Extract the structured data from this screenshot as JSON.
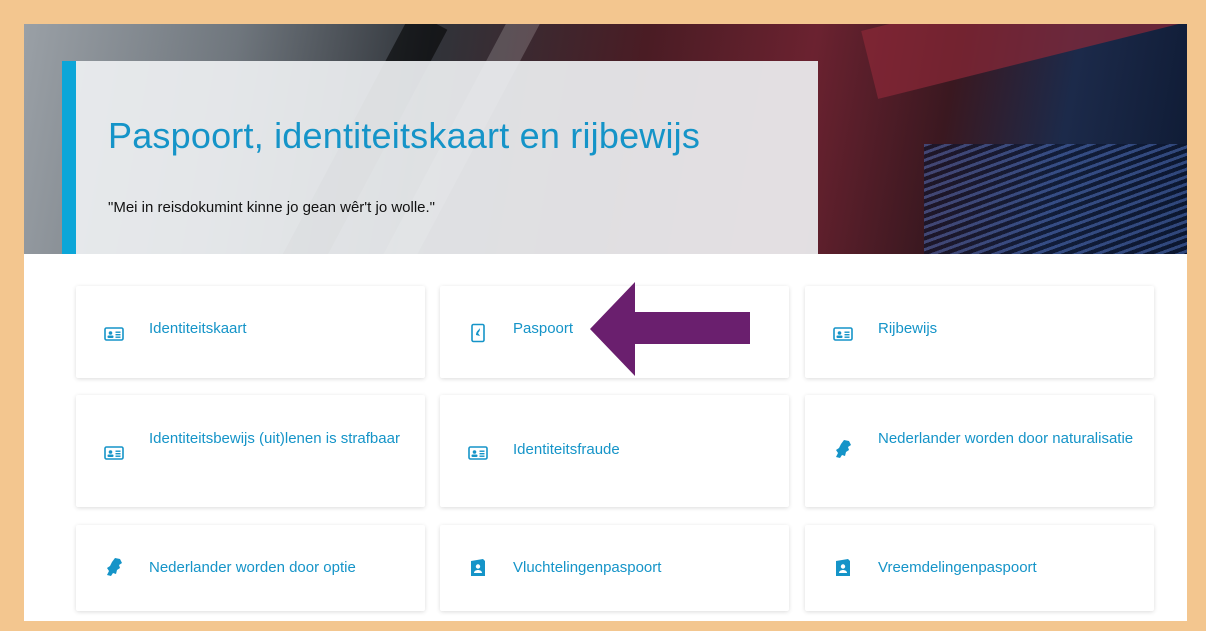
{
  "hero": {
    "title": "Paspoort, identiteitskaart en rijbewijs",
    "subtitle": "\"Mei in reisdokumint kinne jo gean wêr't jo wolle.\""
  },
  "colors": {
    "accent": "#1594c8",
    "panel_bar": "#0ca6d8",
    "frame": "#f3c68f",
    "arrow": "#6a1f6e"
  },
  "cards": [
    {
      "label": "Identiteitskaart",
      "icon": "id-card-icon"
    },
    {
      "label": "Paspoort",
      "icon": "passport-icon"
    },
    {
      "label": "Rijbewijs",
      "icon": "drivers-license-icon"
    },
    {
      "label": "Identiteitsbewijs (uit)lenen is strafbaar",
      "icon": "id-card-icon"
    },
    {
      "label": "Identiteitsfraude",
      "icon": "id-card-icon"
    },
    {
      "label": "Nederlander worden door naturalisatie",
      "icon": "netherlands-map-icon"
    },
    {
      "label": "Nederlander worden door optie",
      "icon": "netherlands-map-icon"
    },
    {
      "label": "Vluchtelingenpaspoort",
      "icon": "travel-document-icon"
    },
    {
      "label": "Vreemdelingenpaspoort",
      "icon": "travel-document-icon"
    }
  ],
  "annotation": {
    "arrow": "arrow-left-icon",
    "points_to": "Paspoort"
  }
}
